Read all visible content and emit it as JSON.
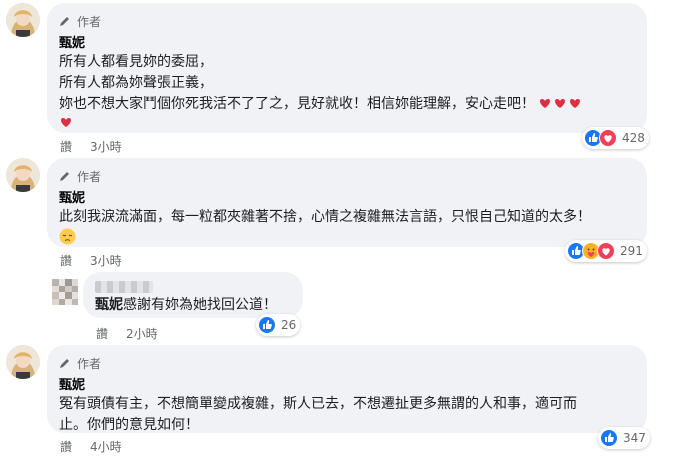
{
  "author_badge": "作者",
  "comments": [
    {
      "name": "甄妮",
      "lines": [
        "所有人都看見妳的委屈，",
        "所有人都為妳聲張正義，",
        "妳也不想大家鬥個你死我活不了了之，見好就收！相信妳能理解，安心走吧！"
      ],
      "action": "讚",
      "time": "3小時",
      "reaction_count": "428"
    },
    {
      "name": "甄妮",
      "lines": [
        "此刻我淚流滿面，每一粒都夾雜著不捨，心情之複雜無法言語，只恨自己知道的太多！"
      ],
      "action": "讚",
      "time": "3小時",
      "reaction_count": "291"
    },
    {
      "name": "甄妮",
      "lines": [
        "冤有頭債有主，不想簡單變成複雜，斯人已去，不想遷扯更多無謂的人和事，適可而",
        "止。你們的意見如何！"
      ],
      "action": "讚",
      "time": "4小時",
      "reaction_count": "347"
    }
  ],
  "reply": {
    "mention": "甄妮",
    "text": "感謝有妳為她找回公道！",
    "action": "讚",
    "time": "2小時",
    "reaction_count": "26"
  },
  "colors": {
    "bubble": "#f0f2f5",
    "like_blue": "#1877f2",
    "love_red": "#f33e58",
    "meta_gray": "#65676b"
  },
  "icons": [
    "pen-icon",
    "like-reaction-icon",
    "love-reaction-icon",
    "care-reaction-icon",
    "heart-emoji-icon",
    "pensive-face-emoji-icon"
  ]
}
